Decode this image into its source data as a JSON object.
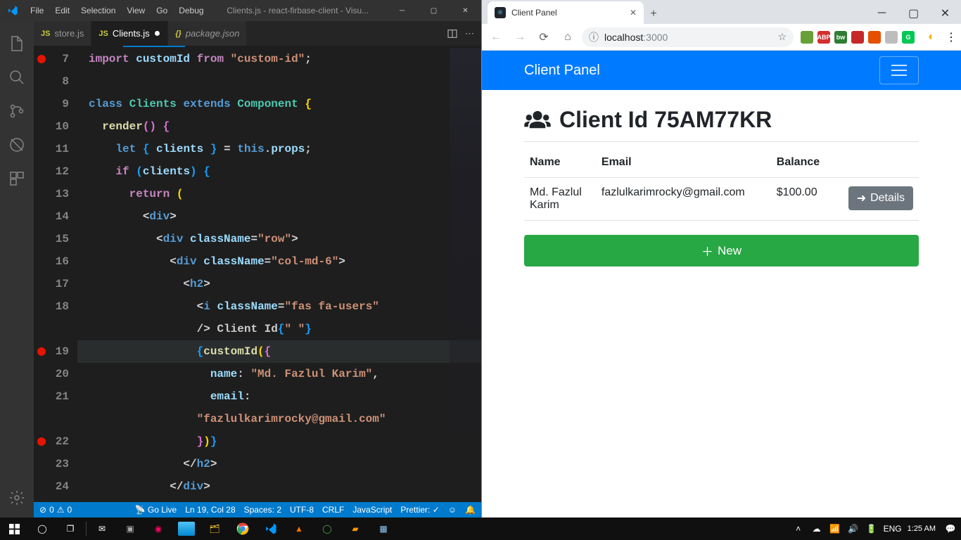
{
  "vscode": {
    "menu": [
      "File",
      "Edit",
      "Selection",
      "View",
      "Go",
      "Debug"
    ],
    "windowTitle": "Clients.js - react-firbase-client - Visu...",
    "tabs": [
      {
        "label": "store.js",
        "active": false,
        "italic": false,
        "dirty": false
      },
      {
        "label": "Clients.js",
        "active": true,
        "italic": false,
        "dirty": true
      },
      {
        "label": "package.json",
        "active": false,
        "italic": true,
        "dirty": false
      }
    ],
    "breakpoints": [
      7,
      19,
      22
    ],
    "lineStart": 7,
    "lineEnd": 24,
    "currentLine": 19,
    "lines": {
      "7": {
        "html": "<span class='kw'>import</span> <span class='var'>customId</span> <span class='kw'>from</span> <span class='str'>\"custom-id\"</span><span class='pun'>;</span>"
      },
      "8": {
        "html": ""
      },
      "9": {
        "html": "<span class='tag'>class</span> <span class='cls'>Clients</span> <span class='tag'>extends</span> <span class='cls'>Component</span> <span class='brace1'>{</span>"
      },
      "10": {
        "html": "  <span class='fn'>render</span><span class='brace2'>()</span> <span class='brace2'>{</span>"
      },
      "11": {
        "html": "    <span class='tag'>let</span> <span class='brace3'>{</span> <span class='var'>clients</span> <span class='brace3'>}</span> <span class='pun'>=</span> <span class='tag'>this</span><span class='pun'>.</span><span class='var'>props</span><span class='pun'>;</span>"
      },
      "12": {
        "html": "    <span class='kw'>if</span> <span class='brace3'>(</span><span class='var'>clients</span><span class='brace3'>)</span> <span class='brace3'>{</span>"
      },
      "13": {
        "html": "      <span class='kw'>return</span> <span class='brace1'>(</span>"
      },
      "14": {
        "html": "        <span class='pun'>&lt;</span><span class='tag'>div</span><span class='pun'>&gt;</span>"
      },
      "15": {
        "html": "          <span class='pun'>&lt;</span><span class='tag'>div</span> <span class='attr'>className</span><span class='pun'>=</span><span class='str'>\"row\"</span><span class='pun'>&gt;</span>"
      },
      "16": {
        "html": "            <span class='pun'>&lt;</span><span class='tag'>div</span> <span class='attr'>className</span><span class='pun'>=</span><span class='str'>\"col-md-6\"</span><span class='pun'>&gt;</span>"
      },
      "17": {
        "html": "              <span class='pun'>&lt;</span><span class='tag'>h2</span><span class='pun'>&gt;</span>"
      },
      "18": {
        "html": "                <span class='pun'>&lt;</span><span class='tag'>i</span> <span class='attr'>className</span><span class='pun'>=</span><span class='str'>\"fas fa-users\"</span>"
      },
      "18b": {
        "html": "                <span class='pun'>/&gt;</span> Client Id<span class='brace3'>{</span><span class='str'>\" \"</span><span class='brace3'>}</span>"
      },
      "19": {
        "html": "                <span class='brace3'>{</span><span class='fn'>customId</span><span class='brace1'>(</span><span class='brace2'>{</span>"
      },
      "20": {
        "html": "                  <span class='var'>name</span><span class='pun'>:</span> <span class='str'>\"Md. Fazlul Karim\"</span><span class='pun'>,</span>"
      },
      "21": {
        "html": "                  <span class='var'>email</span><span class='pun'>:</span>"
      },
      "21b": {
        "html": "                <span class='str'>\"fazlulkarimrocky@gmail.com\"</span>"
      },
      "22": {
        "html": "                <span class='brace2'>}</span><span class='brace1'>)</span><span class='brace3'>}</span>"
      },
      "23": {
        "html": "              <span class='pun'>&lt;/</span><span class='tag'>h2</span><span class='pun'>&gt;</span>"
      },
      "24": {
        "html": "            <span class='pun'>&lt;/</span><span class='tag'>div</span><span class='pun'>&gt;</span>"
      }
    },
    "statusbar": {
      "errors": 0,
      "warnings": 0,
      "goLive": "Go Live",
      "cursor": "Ln 19, Col 28",
      "spaces": "Spaces: 2",
      "encoding": "UTF-8",
      "eol": "CRLF",
      "lang": "JavaScript",
      "prettier": "Prettier: ✓"
    }
  },
  "browser": {
    "tabTitle": "Client Panel",
    "url": {
      "host": "localhost",
      "path": ":3000"
    },
    "extensions": [
      {
        "bg": "#689f38",
        "text": ""
      },
      {
        "bg": "#d32f2f",
        "text": "ABP"
      },
      {
        "bg": "#2e7d32",
        "text": "bw"
      },
      {
        "bg": "#c62828",
        "text": ""
      },
      {
        "bg": "#e65100",
        "text": ""
      },
      {
        "bg": "#bdbdbd",
        "text": ""
      },
      {
        "bg": "#00c853",
        "text": "G"
      }
    ],
    "page": {
      "brand": "Client Panel",
      "headingPrefix": "Client Id",
      "clientId": "75AM77KR",
      "columns": [
        "Name",
        "Email",
        "Balance",
        ""
      ],
      "rows": [
        {
          "name": "Md. Fazlul Karim",
          "email": "fazlulkarimrocky@gmail.com",
          "balance": "$100.00",
          "action": "Details"
        }
      ],
      "newBtn": "New"
    }
  },
  "taskbar": {
    "lang": "ENG",
    "time": "1:25 AM"
  }
}
